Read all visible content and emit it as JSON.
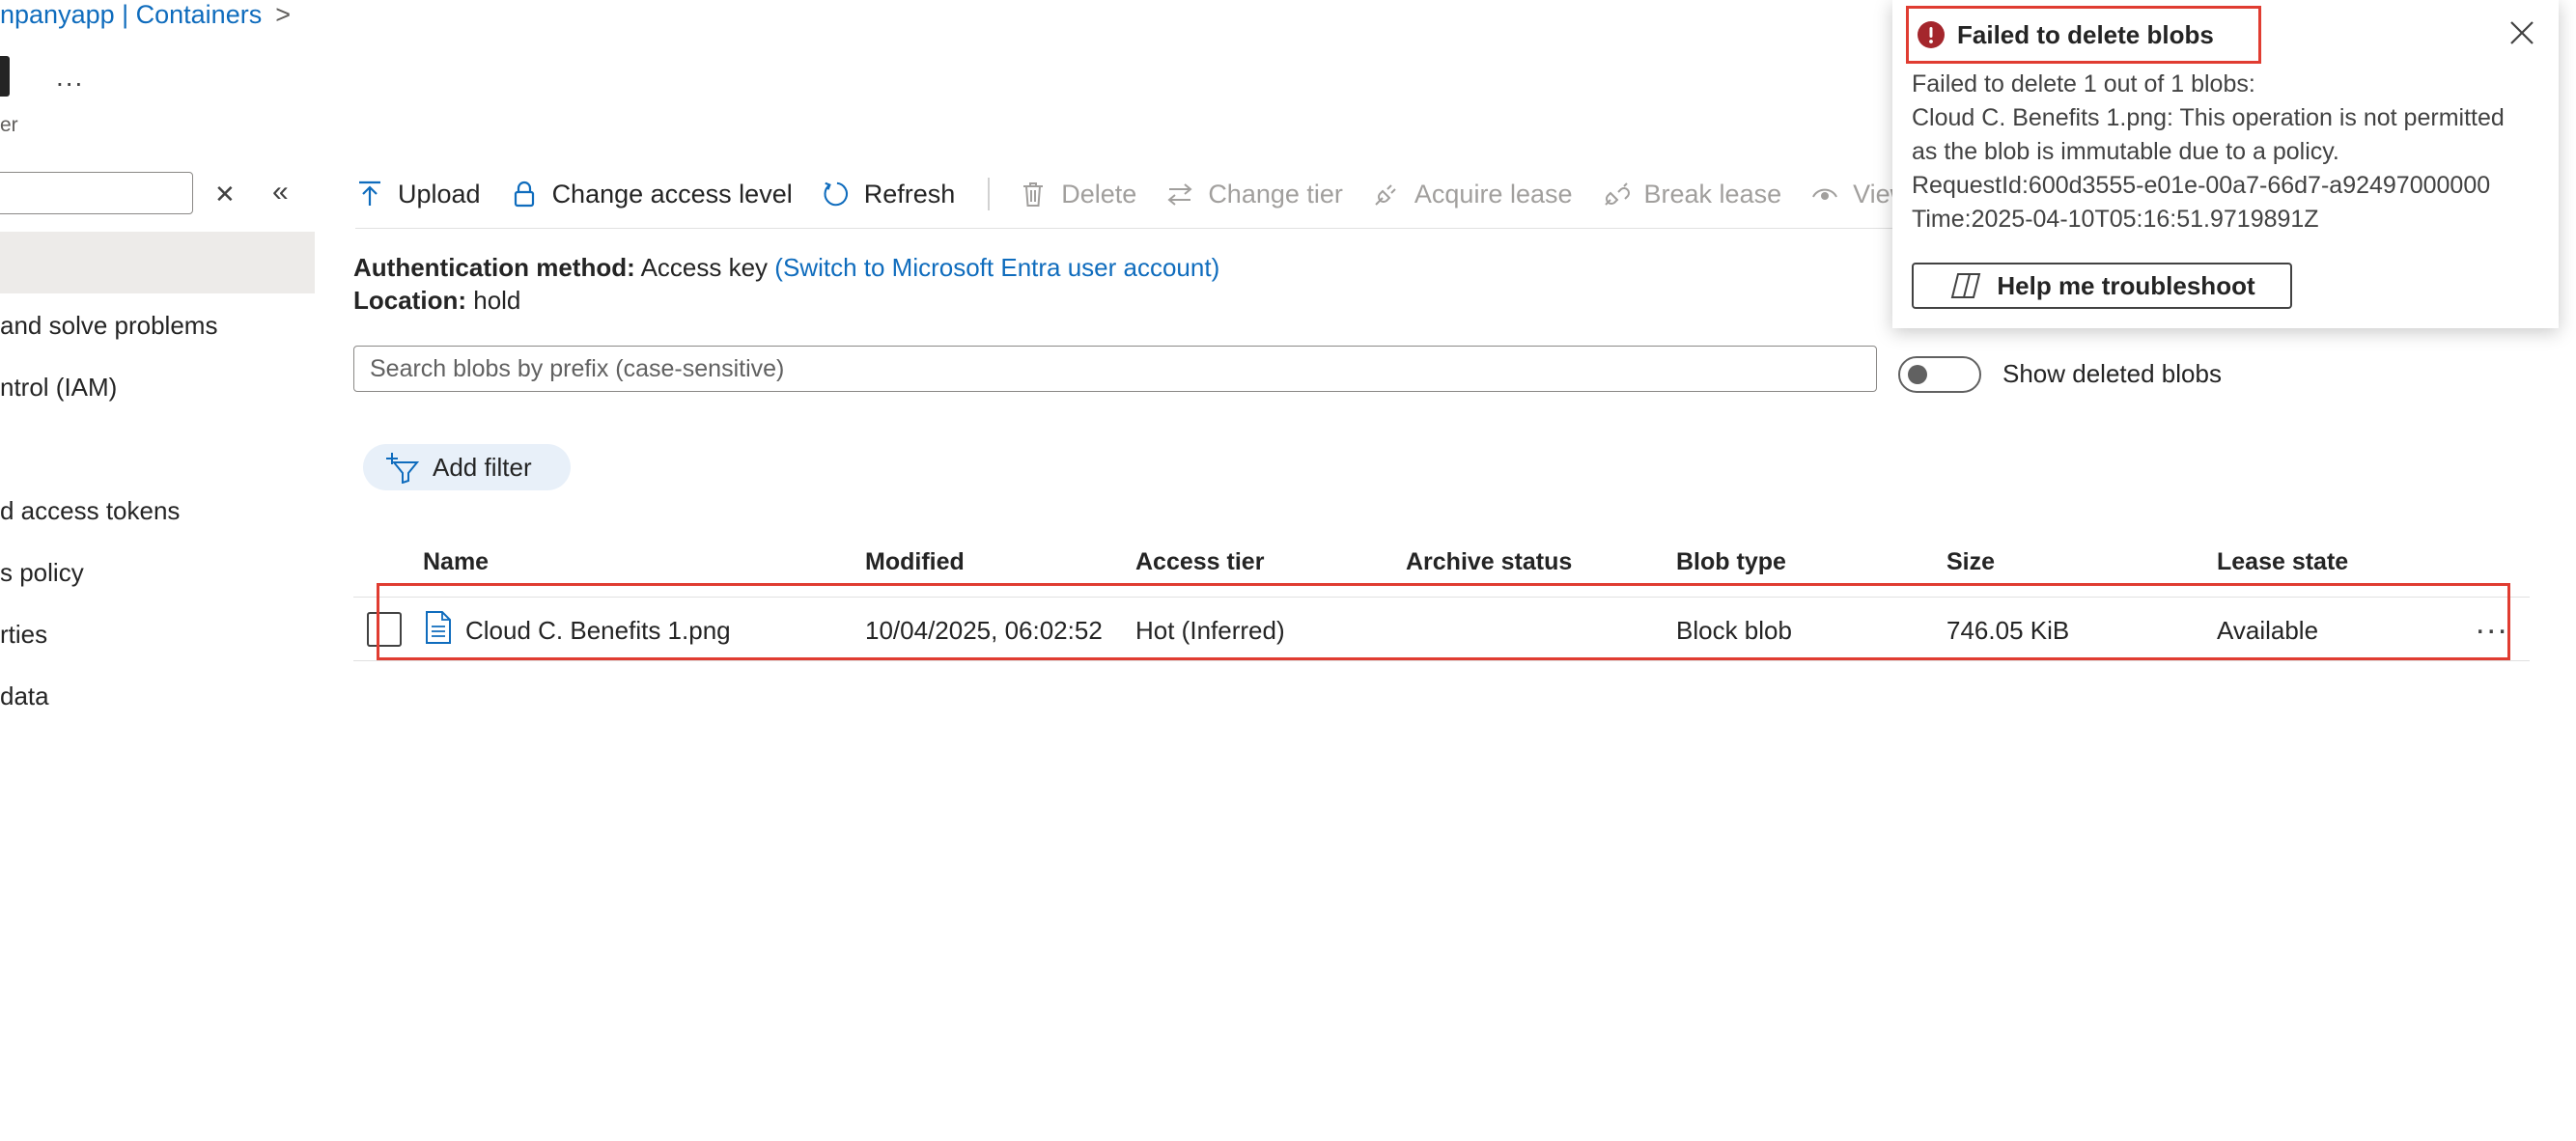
{
  "breadcrumb": {
    "text": "npanyapp | Containers",
    "chevron": ">"
  },
  "title_more": "...",
  "subtitle_fragment": "er",
  "nav": {
    "clear_icon": "✕",
    "collapse_icon": "«",
    "items": [
      {
        "label": "and solve problems"
      },
      {
        "label": "ntrol (IAM)"
      },
      {
        "label": "d access tokens"
      },
      {
        "label": "s policy"
      },
      {
        "label": "rties"
      },
      {
        "label": "data"
      }
    ]
  },
  "toolbar": {
    "upload": "Upload",
    "change_access_level": "Change access level",
    "refresh": "Refresh",
    "delete": "Delete",
    "change_tier": "Change tier",
    "acquire_lease": "Acquire lease",
    "break_lease": "Break lease",
    "view": "View"
  },
  "auth": {
    "label": "Authentication method:",
    "value": "Access key",
    "switch_link": "(Switch to Microsoft Entra user account)"
  },
  "location": {
    "label": "Location:",
    "value": "hold"
  },
  "search": {
    "placeholder": "Search blobs by prefix (case-sensitive)"
  },
  "show_deleted": {
    "label": "Show deleted blobs",
    "enabled": false
  },
  "add_filter": "Add filter",
  "table": {
    "columns": [
      "Name",
      "Modified",
      "Access tier",
      "Archive status",
      "Blob type",
      "Size",
      "Lease state"
    ],
    "rows": [
      {
        "name": "Cloud C. Benefits 1.png",
        "modified": "10/04/2025, 06:02:52",
        "access_tier": "Hot (Inferred)",
        "archive_status": "",
        "blob_type": "Block blob",
        "size": "746.05 KiB",
        "lease_state": "Available",
        "more": "..."
      }
    ]
  },
  "notification": {
    "title": "Failed to delete blobs",
    "summary": "Failed to delete 1 out of 1 blobs:",
    "message": "Cloud C. Benefits 1.png: This operation is not permitted as the blob is immutable due to a policy.",
    "request_id": "RequestId:600d3555-e01e-00a7-66d7-a92497000000",
    "time": "Time:2025-04-10T05:16:51.9719891Z",
    "button": "Help me troubleshoot",
    "error_color": "#a4262c"
  },
  "colors": {
    "accent": "#0f6cbd",
    "highlight_box": "#e03c31",
    "selected_nav": "#edebe9"
  }
}
